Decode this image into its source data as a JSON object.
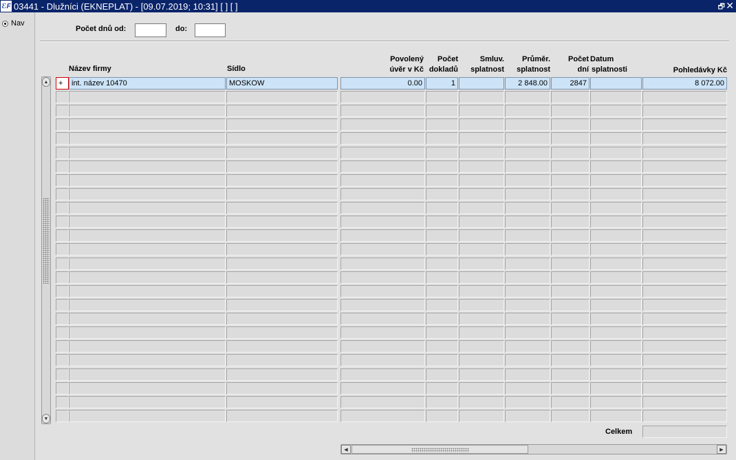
{
  "window": {
    "title": "03441 - Dlužníci (EKNEPLAT) - [09.07.2019; 10:31]  [ ]  [ ]",
    "app_icon_text": "ℰF",
    "restore_glyph": "🗗",
    "close_glyph": "✕"
  },
  "nav": {
    "label": "Nav",
    "selected": true
  },
  "filter": {
    "from_label": "Počet dnů od:",
    "from_value": "",
    "to_label": "do:",
    "to_value": ""
  },
  "columns": {
    "firm": "Název firmy",
    "seat": "Sídlo",
    "credit": [
      "Povolený",
      "úvěr v Kč"
    ],
    "docs": [
      "Počet",
      "dokladů"
    ],
    "contract": [
      "Smluv.",
      "splatnost"
    ],
    "avg": [
      "Průměr.",
      "splatnost"
    ],
    "days": [
      "Počet",
      "dní"
    ],
    "duedate": [
      "Datum",
      "splatnosti"
    ],
    "receivables": "Pohledávky Kč"
  },
  "rows": [
    {
      "indicator": "+",
      "firm": "int. název 10470",
      "seat": "MOSKOW",
      "credit": "0.00",
      "docs": "1",
      "contract": "",
      "avg": "2 848.00",
      "days": "2847",
      "duedate": "",
      "receivables": "8 072.00"
    }
  ],
  "empty_row_count": 24,
  "totals": {
    "label": "Celkem",
    "value": ""
  },
  "icons": {
    "scroll_up": "▲",
    "scroll_down": "▼",
    "scroll_left": "◀",
    "scroll_right": "▶"
  }
}
